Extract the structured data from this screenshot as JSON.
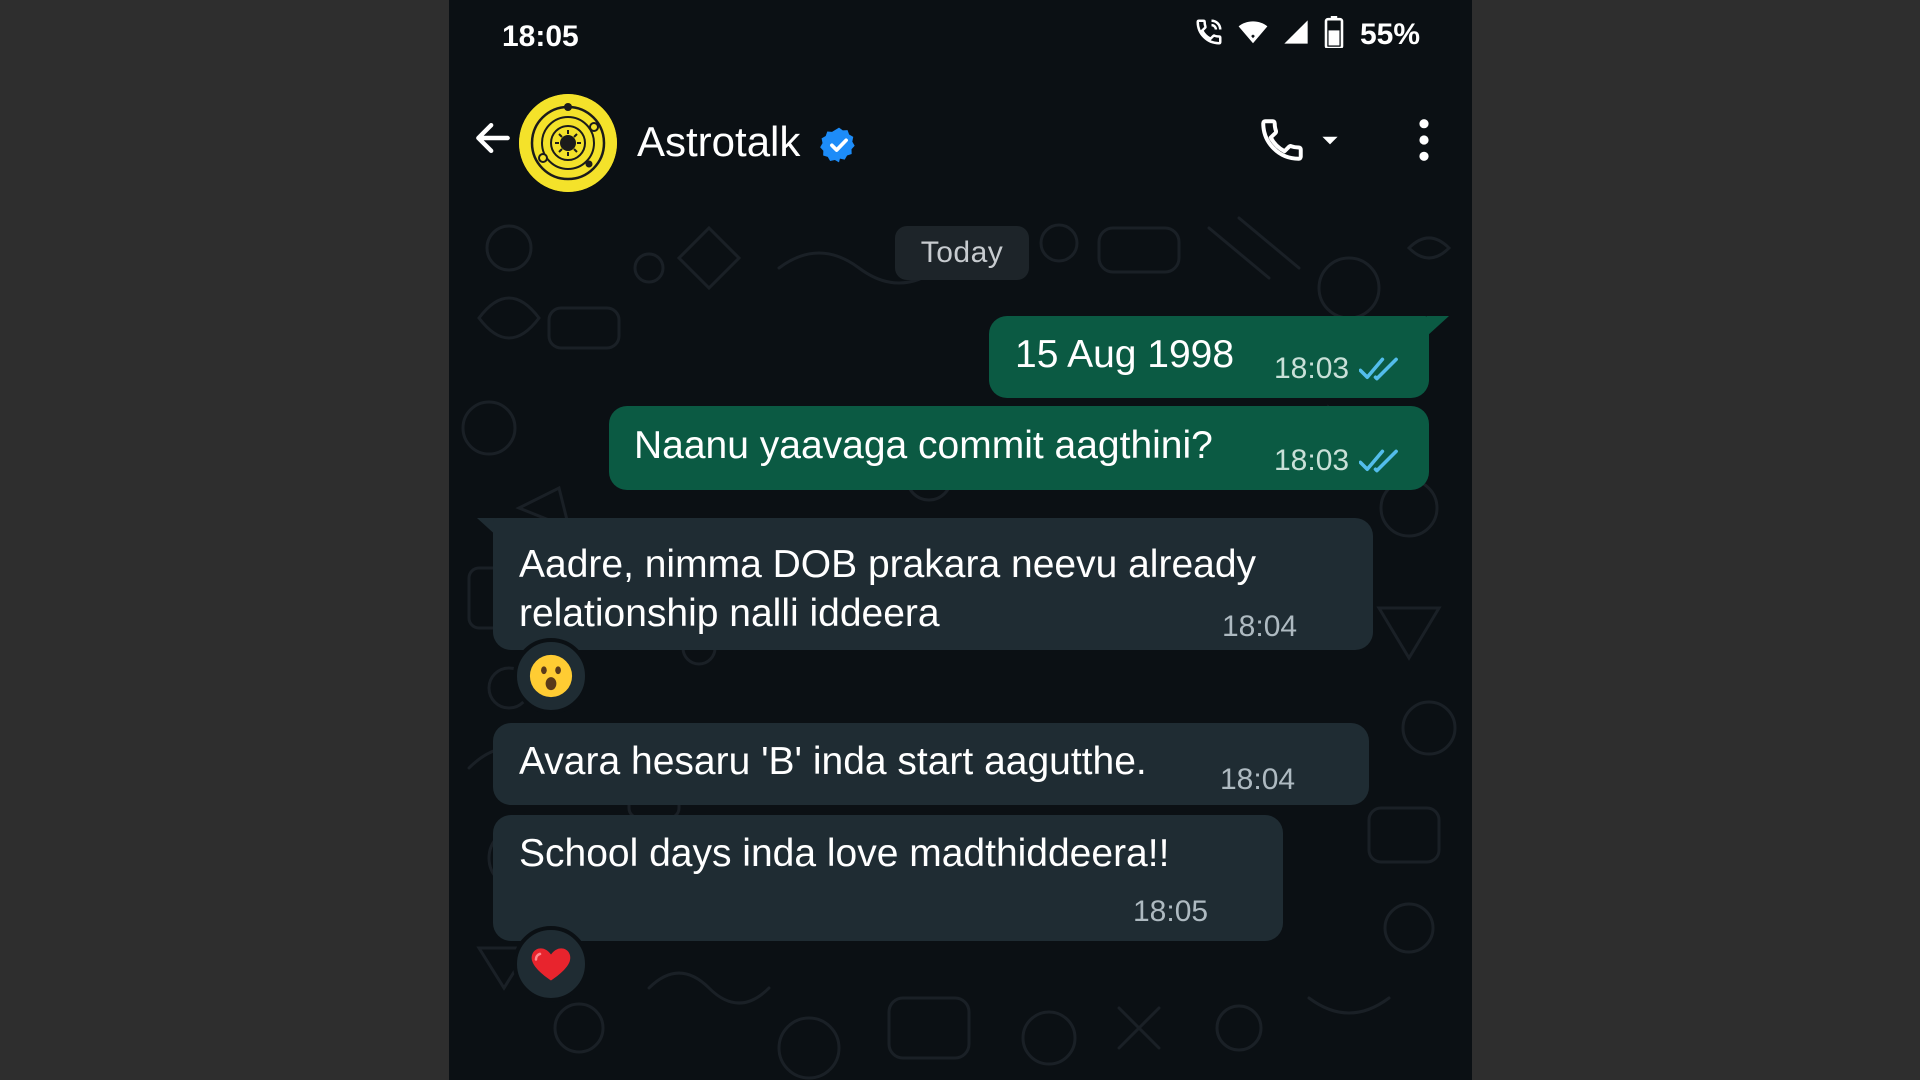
{
  "status_bar": {
    "time": "18:05",
    "battery_percent": "55%",
    "icons": [
      "wifi-calling-icon",
      "wifi-icon",
      "cell-signal-icon",
      "battery-icon"
    ]
  },
  "header": {
    "contact_name": "Astrotalk",
    "verified": true,
    "icons": [
      "back-arrow-icon",
      "avatar",
      "verified-badge-icon",
      "phone-icon",
      "chevron-down-icon",
      "more-vert-icon"
    ]
  },
  "chat": {
    "date_chip": "Today",
    "messages": [
      {
        "direction": "outgoing",
        "text": "15 Aug 1998",
        "time": "18:03",
        "status": "read"
      },
      {
        "direction": "outgoing",
        "text": "Naanu yaavaga commit aagthini?",
        "time": "18:03",
        "status": "read"
      },
      {
        "direction": "incoming",
        "line1": "Aadre, nimma DOB prakara neevu already",
        "line2": "relationship nalli iddeera",
        "time": "18:04",
        "reaction": "😮"
      },
      {
        "direction": "incoming",
        "text": "Avara hesaru 'B' inda start aagutthe.",
        "time": "18:04"
      },
      {
        "direction": "incoming",
        "text": "School days inda love madthiddeera!!",
        "time": "18:05",
        "reaction": "❤️"
      }
    ]
  },
  "colors": {
    "outgoing_bubble": "#0b5a43",
    "incoming_bubble": "#1f2c33",
    "read_ticks": "#53bdeb",
    "verified_badge": "#1d8cf8",
    "avatar_bg": "#f4e22a"
  }
}
